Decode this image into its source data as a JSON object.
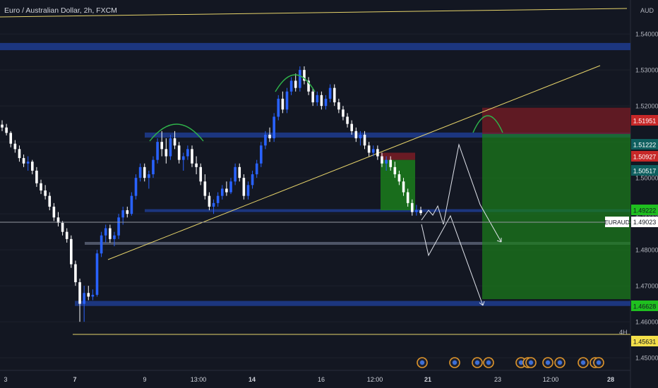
{
  "header": {
    "title": "Euro / Australian Dollar, 2h, FXCM",
    "currency": "AUD"
  },
  "timeframe_label": "4H",
  "colors": {
    "background": "#131722",
    "up_candle": "#2962ff",
    "down_candle": "#ffffff",
    "zone": "#1e3a8a",
    "trend_line": "#e6d36a",
    "target_zone": "#1b7d1b",
    "stop_zone": "#7a1c24",
    "gray_band": "#8088a0",
    "event_marker": "#e0962a"
  },
  "chart_data": {
    "type": "candlestick",
    "symbol": "EURAUD",
    "interval": "2h",
    "ylim": [
      1.4465,
      1.5465
    ],
    "y_ticks": [
      "1.45000",
      "1.46000",
      "1.47000",
      "1.48000",
      "1.49000",
      "1.50000",
      "1.51000",
      "1.52000",
      "1.53000",
      "1.54000"
    ],
    "x_ticks": [
      "3",
      "7",
      "9",
      "13:00",
      "14",
      "16",
      "12:00",
      "21",
      "23",
      "12:00",
      "28"
    ],
    "bold_x_ticks": [
      "7",
      "14",
      "21",
      "28"
    ],
    "candles": [
      [
        1.5148,
        1.516,
        1.513,
        1.514
      ],
      [
        1.514,
        1.515,
        1.5118,
        1.5125
      ],
      [
        1.5125,
        1.513,
        1.5085,
        1.5095
      ],
      [
        1.5095,
        1.5105,
        1.507,
        1.508
      ],
      [
        1.508,
        1.509,
        1.5045,
        1.5055
      ],
      [
        1.5055,
        1.5065,
        1.503,
        1.504
      ],
      [
        1.504,
        1.506,
        1.502,
        1.5045
      ],
      [
        1.5045,
        1.505,
        1.501,
        1.502
      ],
      [
        1.502,
        1.503,
        1.4975,
        1.4985
      ],
      [
        1.4985,
        1.4995,
        1.4955,
        1.4965
      ],
      [
        1.4965,
        1.498,
        1.494,
        1.495
      ],
      [
        1.495,
        1.496,
        1.491,
        1.492
      ],
      [
        1.492,
        1.493,
        1.488,
        1.489
      ],
      [
        1.489,
        1.4905,
        1.4865,
        1.4875
      ],
      [
        1.4875,
        1.488,
        1.484,
        1.485
      ],
      [
        1.485,
        1.486,
        1.482,
        1.483
      ],
      [
        1.483,
        1.484,
        1.475,
        1.476
      ],
      [
        1.476,
        1.477,
        1.47,
        1.471
      ],
      [
        1.471,
        1.472,
        1.46,
        1.465
      ],
      [
        1.465,
        1.47,
        1.46,
        1.468
      ],
      [
        1.468,
        1.47,
        1.466,
        1.467
      ],
      [
        1.467,
        1.469,
        1.466,
        1.4675
      ],
      [
        1.4675,
        1.48,
        1.467,
        1.479
      ],
      [
        1.479,
        1.485,
        1.478,
        1.484
      ],
      [
        1.484,
        1.487,
        1.482,
        1.486
      ],
      [
        1.486,
        1.487,
        1.482,
        1.483
      ],
      [
        1.483,
        1.485,
        1.481,
        1.484
      ],
      [
        1.484,
        1.49,
        1.483,
        1.489
      ],
      [
        1.489,
        1.492,
        1.487,
        1.491
      ],
      [
        1.491,
        1.492,
        1.489,
        1.49
      ],
      [
        1.49,
        1.496,
        1.4895,
        1.495
      ],
      [
        1.495,
        1.501,
        1.494,
        1.5
      ],
      [
        1.5,
        1.504,
        1.499,
        1.503
      ],
      [
        1.503,
        1.504,
        1.499,
        1.5
      ],
      [
        1.5,
        1.502,
        1.497,
        1.501
      ],
      [
        1.501,
        1.506,
        1.5,
        1.505
      ],
      [
        1.505,
        1.511,
        1.504,
        1.51
      ],
      [
        1.51,
        1.513,
        1.506,
        1.508
      ],
      [
        1.508,
        1.511,
        1.504,
        1.506
      ],
      [
        1.506,
        1.512,
        1.505,
        1.511
      ],
      [
        1.511,
        1.513,
        1.508,
        1.509
      ],
      [
        1.509,
        1.51,
        1.504,
        1.505
      ],
      [
        1.505,
        1.507,
        1.502,
        1.506
      ],
      [
        1.506,
        1.509,
        1.505,
        1.508
      ],
      [
        1.508,
        1.509,
        1.503,
        1.504
      ],
      [
        1.504,
        1.506,
        1.501,
        1.503
      ],
      [
        1.503,
        1.504,
        1.498,
        1.499
      ],
      [
        1.499,
        1.501,
        1.494,
        1.495
      ],
      [
        1.495,
        1.496,
        1.491,
        1.492
      ],
      [
        1.492,
        1.494,
        1.49,
        1.493
      ],
      [
        1.493,
        1.496,
        1.492,
        1.495
      ],
      [
        1.495,
        1.498,
        1.494,
        1.497
      ],
      [
        1.497,
        1.499,
        1.495,
        1.496
      ],
      [
        1.496,
        1.5,
        1.4955,
        1.499
      ],
      [
        1.499,
        1.504,
        1.498,
        1.503
      ],
      [
        1.503,
        1.504,
        1.499,
        1.5
      ],
      [
        1.5,
        1.501,
        1.494,
        1.495
      ],
      [
        1.495,
        1.499,
        1.494,
        1.498
      ],
      [
        1.498,
        1.502,
        1.497,
        1.501
      ],
      [
        1.501,
        1.505,
        1.5,
        1.504
      ],
      [
        1.504,
        1.51,
        1.503,
        1.509
      ],
      [
        1.509,
        1.513,
        1.508,
        1.512
      ],
      [
        1.512,
        1.514,
        1.51,
        1.511
      ],
      [
        1.511,
        1.518,
        1.51,
        1.517
      ],
      [
        1.517,
        1.523,
        1.516,
        1.522
      ],
      [
        1.522,
        1.524,
        1.518,
        1.519
      ],
      [
        1.519,
        1.525,
        1.518,
        1.524
      ],
      [
        1.524,
        1.528,
        1.523,
        1.527
      ],
      [
        1.527,
        1.529,
        1.524,
        1.525
      ],
      [
        1.525,
        1.531,
        1.524,
        1.53
      ],
      [
        1.53,
        1.531,
        1.526,
        1.527
      ],
      [
        1.527,
        1.528,
        1.523,
        1.524
      ],
      [
        1.524,
        1.525,
        1.52,
        1.521
      ],
      [
        1.521,
        1.524,
        1.52,
        1.523
      ],
      [
        1.523,
        1.524,
        1.519,
        1.52
      ],
      [
        1.52,
        1.523,
        1.519,
        1.522
      ],
      [
        1.522,
        1.526,
        1.521,
        1.525
      ],
      [
        1.525,
        1.526,
        1.52,
        1.521
      ],
      [
        1.521,
        1.522,
        1.518,
        1.519
      ],
      [
        1.519,
        1.52,
        1.516,
        1.517
      ],
      [
        1.517,
        1.518,
        1.514,
        1.515
      ],
      [
        1.515,
        1.516,
        1.512,
        1.513
      ],
      [
        1.513,
        1.514,
        1.51,
        1.511
      ],
      [
        1.511,
        1.513,
        1.509,
        1.512
      ],
      [
        1.512,
        1.513,
        1.508,
        1.509
      ],
      [
        1.509,
        1.51,
        1.506,
        1.507
      ],
      [
        1.507,
        1.509,
        1.506,
        1.508
      ],
      [
        1.508,
        1.509,
        1.505,
        1.506
      ],
      [
        1.506,
        1.507,
        1.503,
        1.504
      ],
      [
        1.504,
        1.506,
        1.502,
        1.505
      ],
      [
        1.505,
        1.506,
        1.502,
        1.503
      ],
      [
        1.503,
        1.5045,
        1.5,
        1.501
      ],
      [
        1.501,
        1.502,
        1.498,
        1.499
      ],
      [
        1.499,
        1.5,
        1.495,
        1.496
      ],
      [
        1.496,
        1.497,
        1.492,
        1.493
      ],
      [
        1.493,
        1.494,
        1.4895,
        1.4905
      ],
      [
        1.4905,
        1.4925,
        1.4895,
        1.491
      ],
      [
        1.491,
        1.492,
        1.4896,
        1.4902
      ]
    ],
    "horizontal_zones": [
      {
        "top": 1.5375,
        "bottom": 1.5355,
        "start": "left",
        "end": "right"
      },
      {
        "top": 1.5126,
        "bottom": 1.5112,
        "start": "9",
        "end": "right"
      },
      {
        "top": 1.4913,
        "bottom": 1.4905,
        "start": "9",
        "end": "right"
      },
      {
        "top": 1.4658,
        "bottom": 1.4644,
        "start": "7",
        "end": "right"
      }
    ],
    "gray_band": {
      "top": 1.4822,
      "bottom": 1.4814
    },
    "trend_lines": [
      {
        "from": [
          1.5499,
          "left"
        ],
        "to": [
          1.5523,
          "right"
        ]
      },
      {
        "from": [
          1.4793,
          "9"
        ],
        "to": [
          1.5339,
          "right"
        ]
      },
      {
        "from": [
          1.4565,
          "7"
        ],
        "to": [
          1.4565,
          "right"
        ]
      }
    ],
    "positions": [
      {
        "kind": "short",
        "entry": 1.5122,
        "stop": 1.5195,
        "target": 1.4663
      },
      {
        "kind": "short",
        "entry": 1.505,
        "stop": 1.507,
        "target": 1.491
      }
    ],
    "price_labels": [
      {
        "value": "1.51951",
        "color": "#c62828"
      },
      {
        "value": "1.51222",
        "color": "#0f5f5f"
      },
      {
        "value": "1.50927",
        "color": "#c62828"
      },
      {
        "value": "1.50517",
        "color": "#0f5f5f"
      },
      {
        "value": "1.49222",
        "color": "#1fbf1f"
      },
      {
        "value": "1.46628",
        "color": "#1fbf1f"
      },
      {
        "value": "1.45631",
        "color": "#f5e04a"
      }
    ],
    "current": {
      "symbol": "EURAUD",
      "value": "1.49023"
    },
    "event_marker_count": 12
  }
}
